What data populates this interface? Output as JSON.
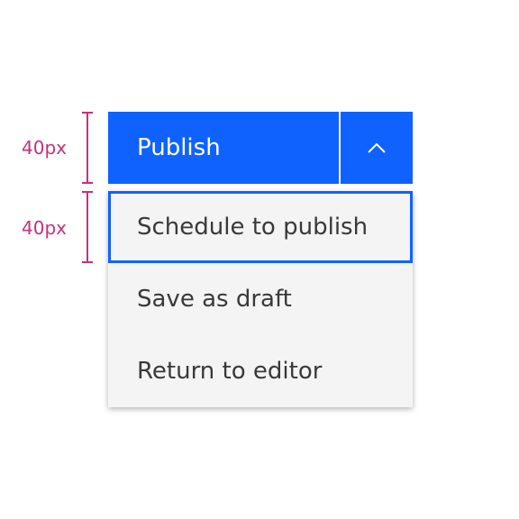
{
  "annotations": {
    "button_height_label": "40px",
    "menu_item_height_label": "40px"
  },
  "combo_button": {
    "primary_label": "Publish",
    "toggle_icon": "chevron-up-icon"
  },
  "menu": {
    "items": [
      {
        "label": "Schedule to publish",
        "state": "focused"
      },
      {
        "label": "Save as draft",
        "state": "default"
      },
      {
        "label": "Return to editor",
        "state": "default"
      }
    ]
  },
  "colors": {
    "primary": "#0f62fe",
    "menu_background": "#f4f4f4",
    "menu_text": "#393939",
    "annotation": "#c6307a",
    "focus_outline": "#0f62fe"
  }
}
